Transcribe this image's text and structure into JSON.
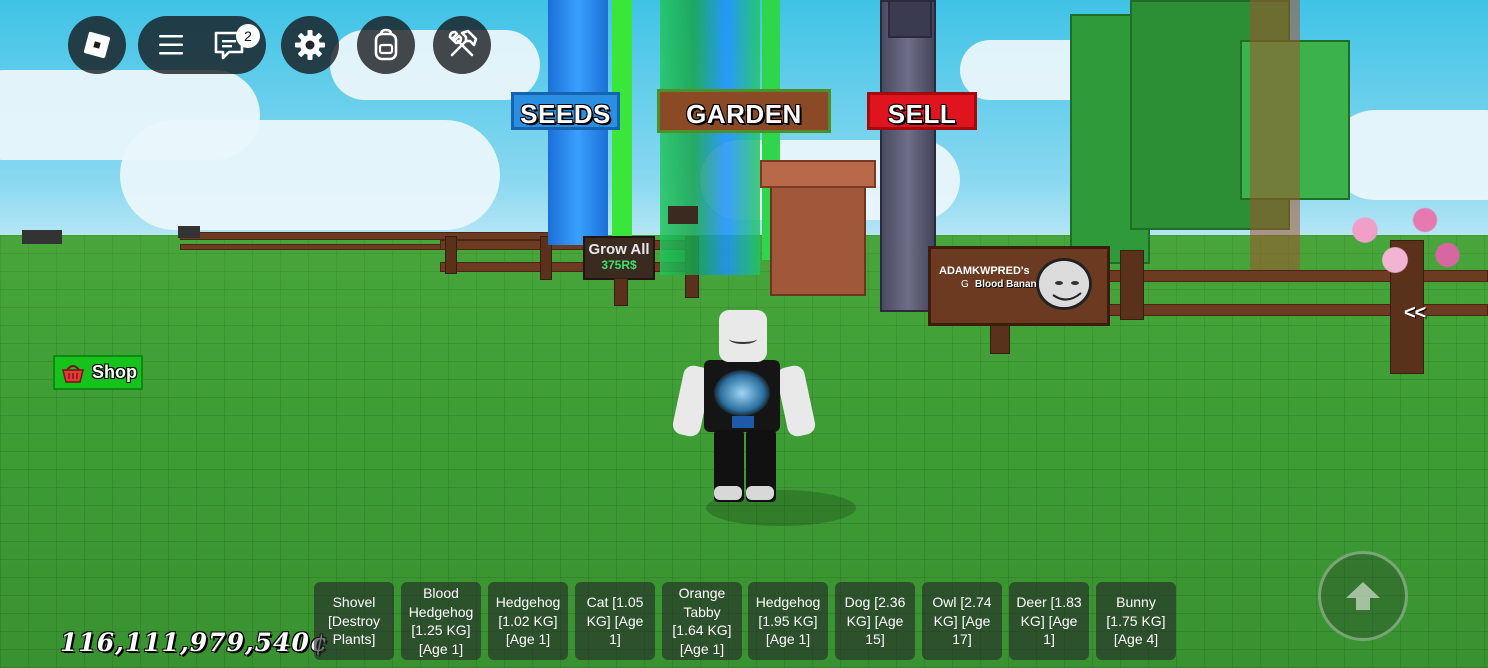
{
  "topbar": {
    "chat_badge": "2"
  },
  "stands": {
    "seeds": "SEEDS",
    "garden": "GARDEN",
    "sell": "SELL"
  },
  "grow_all_sign": {
    "title": "Grow All",
    "price": "375R$"
  },
  "plot_sign": {
    "owner": "ADAMKWPRED's",
    "owner_line2": "G",
    "pet_label": "Blood Banana"
  },
  "shop_button": {
    "label": "Shop"
  },
  "side_toggle": {
    "label": "<<"
  },
  "currency": {
    "amount": "116,111,979,540¢"
  },
  "hotbar": [
    {
      "label": "Shovel\n[Destroy\nPlants]"
    },
    {
      "label": "Blood\nHedgehog\n[1.25 KG]\n[Age 1]"
    },
    {
      "label": "Hedgehog\n[1.02 KG]\n[Age 1]"
    },
    {
      "label": "Cat [1.05\nKG] [Age\n1]"
    },
    {
      "label": "Orange\nTabby\n[1.64 KG]\n[Age 1]"
    },
    {
      "label": "Hedgehog\n[1.95 KG]\n[Age 1]"
    },
    {
      "label": "Dog [2.36\nKG] [Age\n15]"
    },
    {
      "label": "Owl [2.74\nKG] [Age\n17]"
    },
    {
      "label": "Deer [1.83\nKG] [Age\n1]"
    },
    {
      "label": "Bunny\n[1.75 KG]\n[Age 4]"
    }
  ],
  "colors": {
    "seeds_sign": "#2a8fe0",
    "garden_sign": "#8a4a26",
    "sell_sign": "#e0141e",
    "shop_button": "#16c31d",
    "grass": "#3e9e35"
  },
  "icons": {
    "roblox": "roblox-logo-icon",
    "menu": "hamburger-menu-icon",
    "chat": "chat-icon",
    "settings": "gear-icon",
    "backpack": "backpack-icon",
    "tools": "tools-icon",
    "shop": "basket-icon",
    "jump": "jump-arrow-icon"
  }
}
